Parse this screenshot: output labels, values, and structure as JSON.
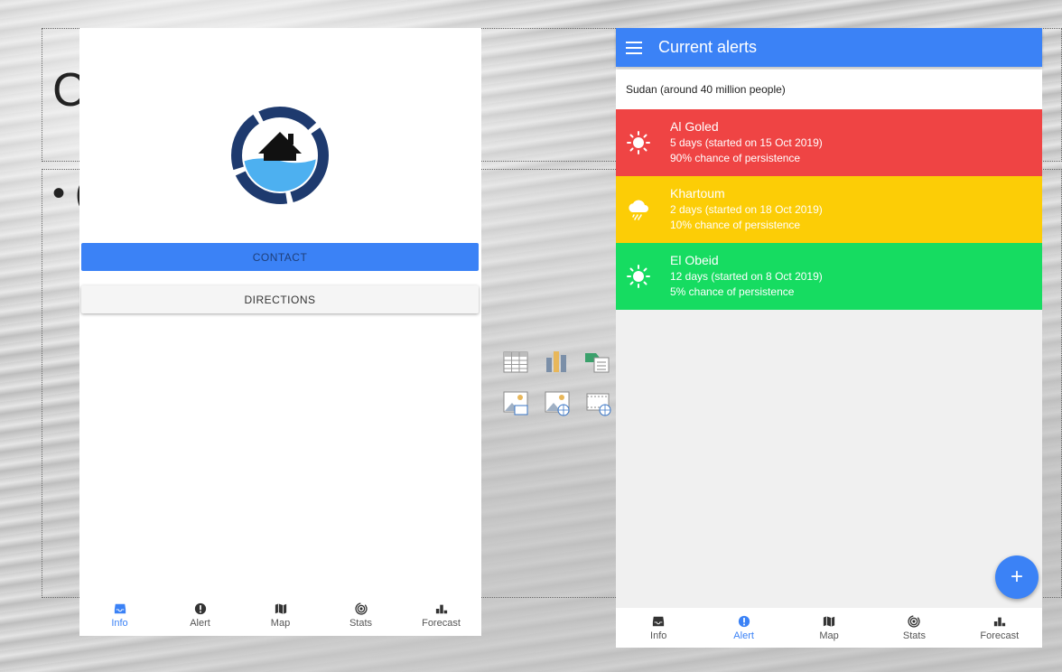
{
  "slide": {
    "title_fragment": "C",
    "bullet_fragment": "• ("
  },
  "left_app": {
    "contact_button": "CONTACT",
    "directions_button": "DIRECTIONS",
    "tabs": [
      {
        "label": "Info",
        "icon": "inbox-icon",
        "active": true
      },
      {
        "label": "Alert",
        "icon": "alert-circle-icon",
        "active": false
      },
      {
        "label": "Map",
        "icon": "map-icon",
        "active": false
      },
      {
        "label": "Stats",
        "icon": "broadcast-icon",
        "active": false
      },
      {
        "label": "Forecast",
        "icon": "bar-chart-icon",
        "active": false
      }
    ]
  },
  "right_app": {
    "title": "Current alerts",
    "region": "Sudan (around 40 million people)",
    "alerts": [
      {
        "city": "Al Goled",
        "duration": "5 days (started on 15 Oct 2019)",
        "persistence": "90% chance of persistence",
        "color": "#ef4444",
        "icon": "sun-icon"
      },
      {
        "city": "Khartoum",
        "duration": "2 days (started on 18 Oct 2019)",
        "persistence": "10% chance of persistence",
        "color": "#facc15",
        "icon": "cloud-rain-icon"
      },
      {
        "city": "El Obeid",
        "duration": "12 days (started on 8 Oct 2019)",
        "persistence": "5% chance of persistence",
        "color": "#16dc61",
        "icon": "sun-icon"
      }
    ],
    "fab_label": "+",
    "tabs": [
      {
        "label": "Info",
        "icon": "inbox-icon",
        "active": false
      },
      {
        "label": "Alert",
        "icon": "alert-circle-icon",
        "active": true
      },
      {
        "label": "Map",
        "icon": "map-icon",
        "active": false
      },
      {
        "label": "Stats",
        "icon": "broadcast-icon",
        "active": false
      },
      {
        "label": "Forecast",
        "icon": "bar-chart-icon",
        "active": false
      }
    ]
  },
  "colors": {
    "accent": "#3b82f6",
    "logo_navy": "#1e3a6e",
    "logo_water": "#4db0f0"
  }
}
